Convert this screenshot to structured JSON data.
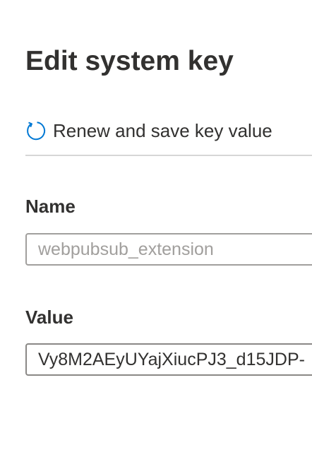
{
  "dialog": {
    "title": "Edit system key"
  },
  "toolbar": {
    "renew_label": "Renew and save key value",
    "renew_icon": "refresh-icon",
    "accent_color": "#0078d4"
  },
  "form": {
    "name": {
      "label": "Name",
      "value": "webpubsub_extension",
      "disabled": true
    },
    "value": {
      "label": "Value",
      "value": "Vy8M2AEyUYajXiucPJ3_d15JDP-"
    }
  }
}
